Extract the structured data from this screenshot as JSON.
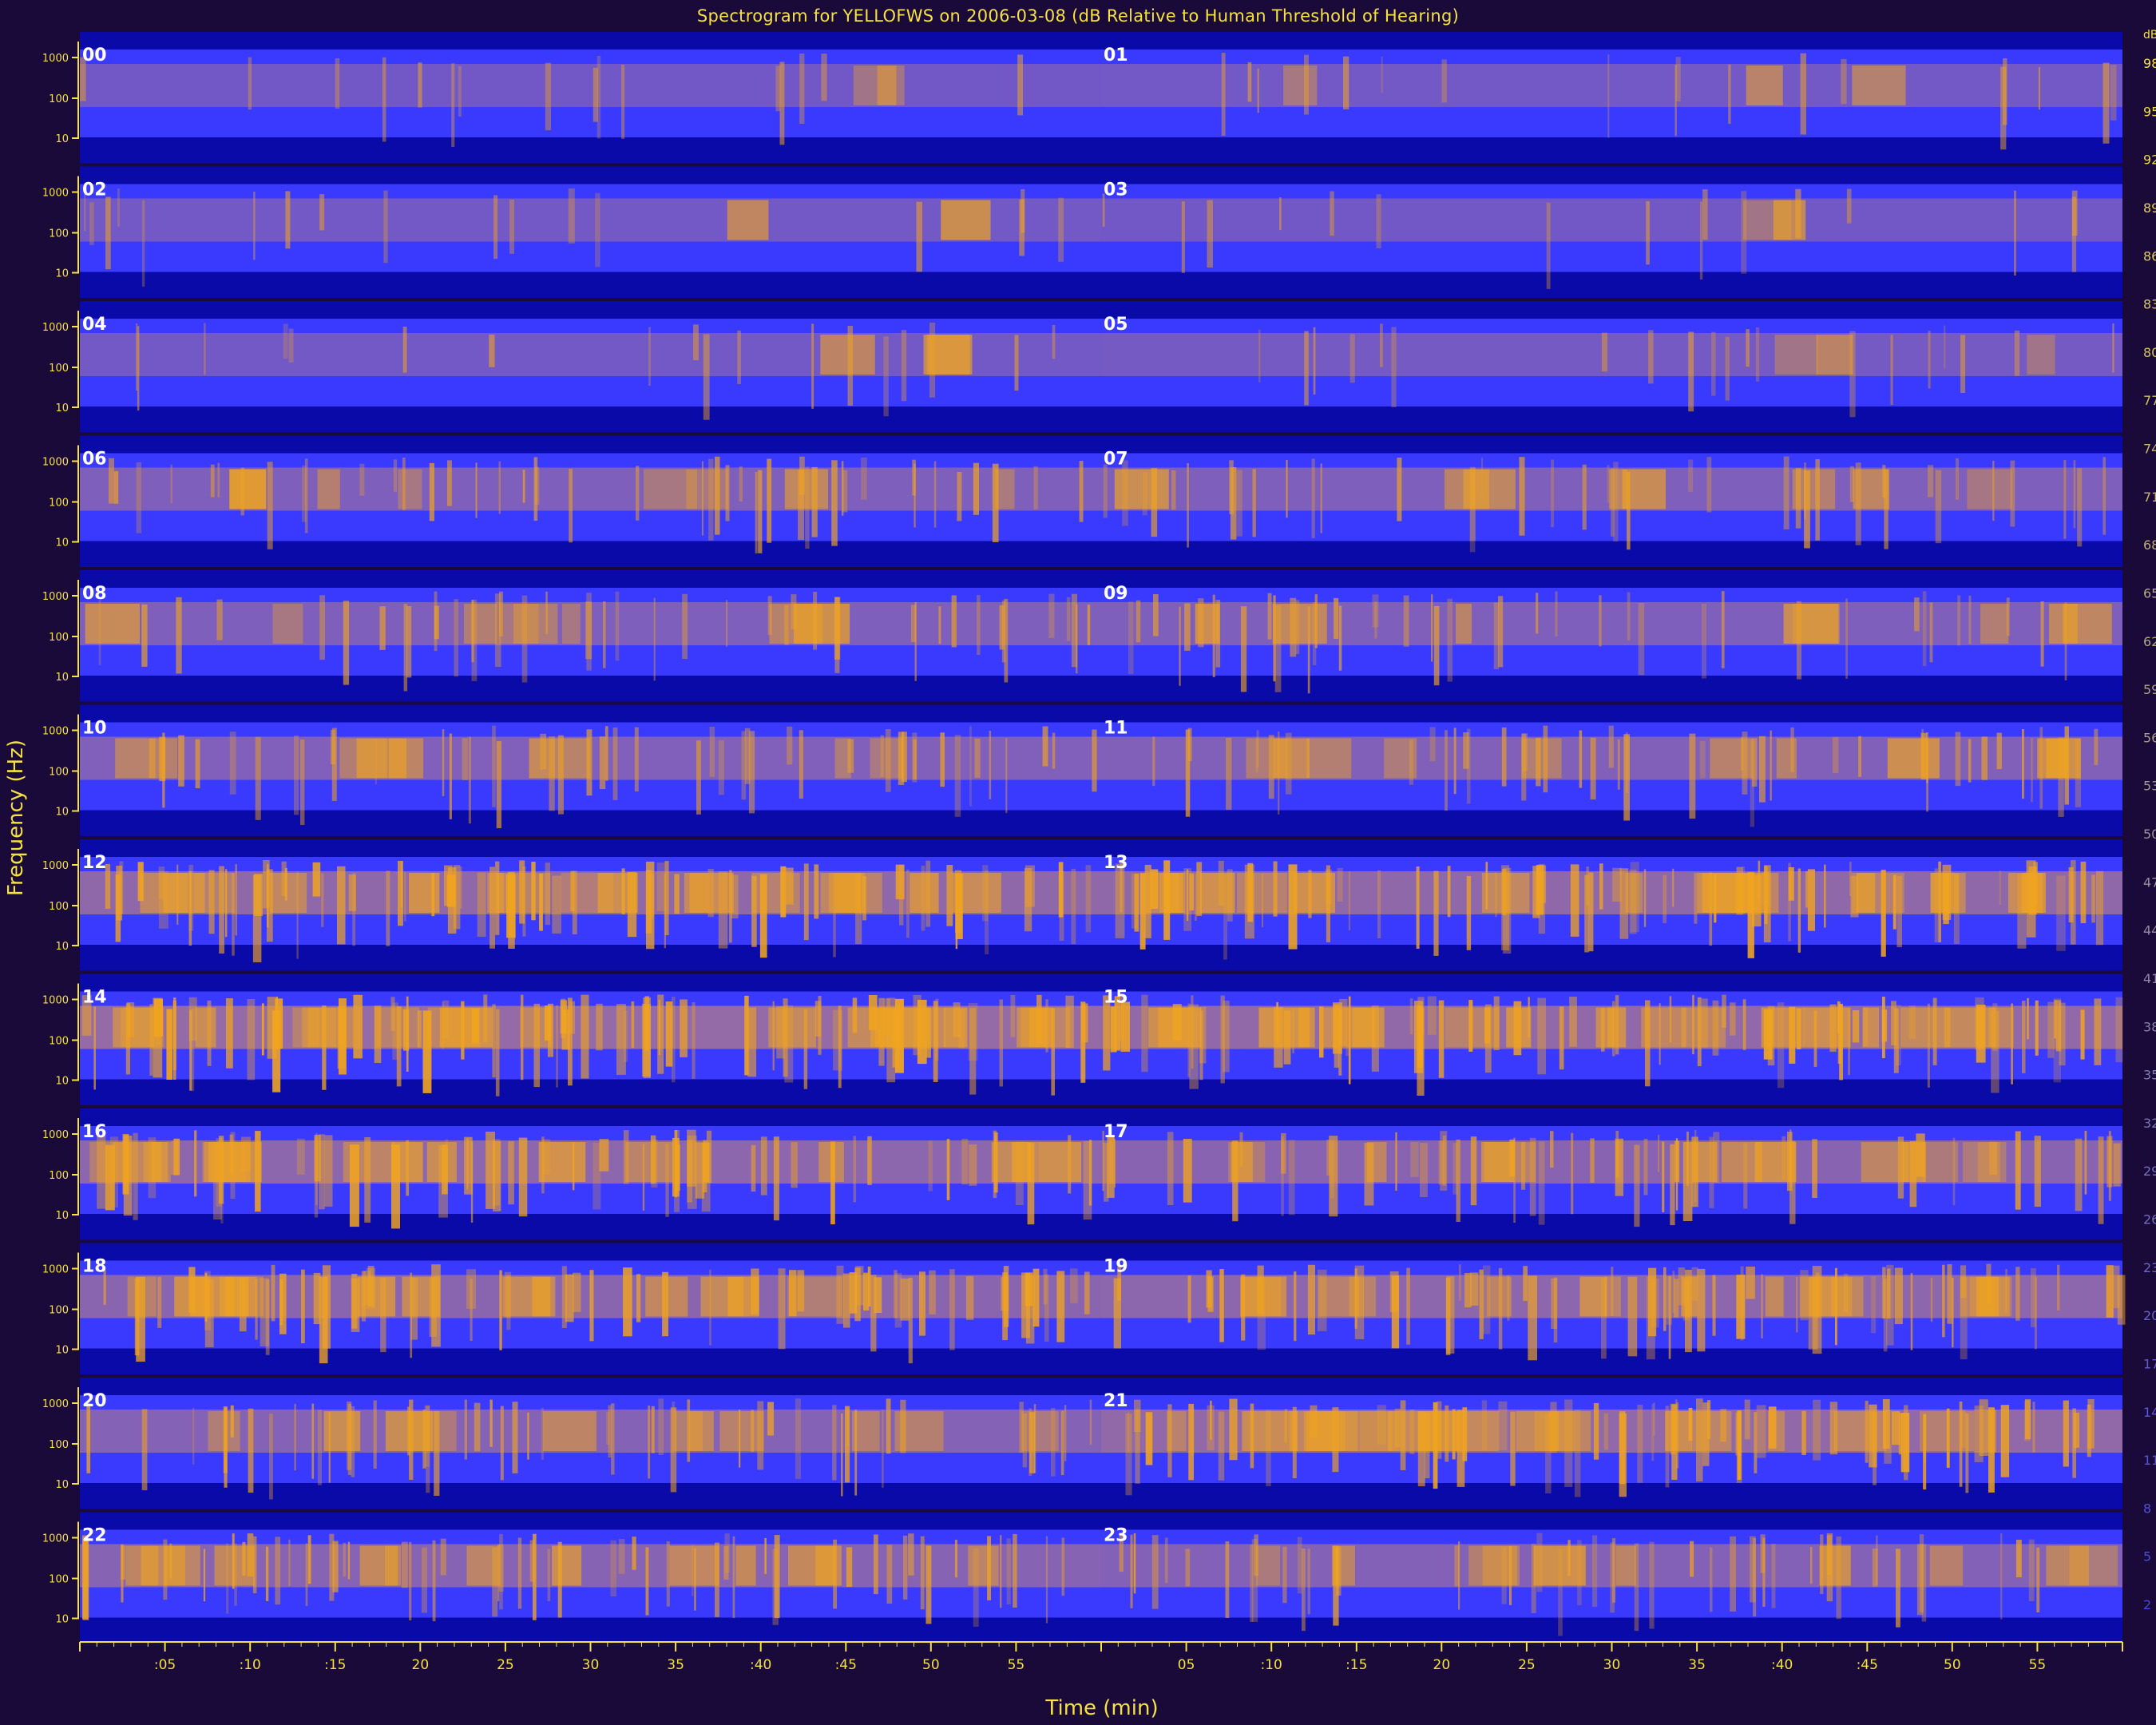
{
  "chart_data": {
    "type": "heatmap",
    "title": "Spectrogram for YELLOFWS on 2006-03-08 (dB Relative to Human Threshold of Hearing)",
    "xlabel": "Time (min)",
    "ylabel": "Frequency (Hz)",
    "x_tick_labels": [
      ":05",
      ":10",
      ":15",
      "20",
      "25",
      "30",
      "35",
      ":40",
      ":45",
      "50",
      "55",
      "05",
      ":10",
      ":15",
      "20",
      "25",
      "30",
      "35",
      ":40",
      ":45",
      "50",
      "55"
    ],
    "freq_tick_labels": [
      "1000",
      "100",
      "10"
    ],
    "colorbar_unit": "dB",
    "colorbar_ticks": [
      98,
      95,
      92,
      89,
      86,
      83,
      80,
      77,
      74,
      71,
      68,
      65,
      62,
      59,
      56,
      53,
      50,
      47,
      44,
      41,
      38,
      35,
      32,
      29,
      26,
      23,
      20,
      17,
      14,
      11,
      8,
      5,
      2
    ],
    "colorbar_range": [
      0,
      100
    ],
    "colormap": [
      "#f0a420",
      "#b07a8a",
      "#3a3aff",
      "#0a0aa8"
    ],
    "hour_labels": [
      "00",
      "01",
      "02",
      "03",
      "04",
      "05",
      "06",
      "07",
      "08",
      "09",
      "10",
      "11",
      "12",
      "13",
      "14",
      "15",
      "16",
      "17",
      "18",
      "19",
      "20",
      "21",
      "22",
      "23"
    ],
    "hour_intensity": [
      0.08,
      0.1,
      0.09,
      0.08,
      0.1,
      0.12,
      0.33,
      0.32,
      0.32,
      0.32,
      0.36,
      0.38,
      0.7,
      0.7,
      0.78,
      0.72,
      0.62,
      0.52,
      0.58,
      0.62,
      0.45,
      0.72,
      0.5,
      0.4
    ]
  },
  "colors": {
    "background": "#1a0a3a",
    "axis": "#f5e142",
    "hour_label": "#ffffff"
  }
}
